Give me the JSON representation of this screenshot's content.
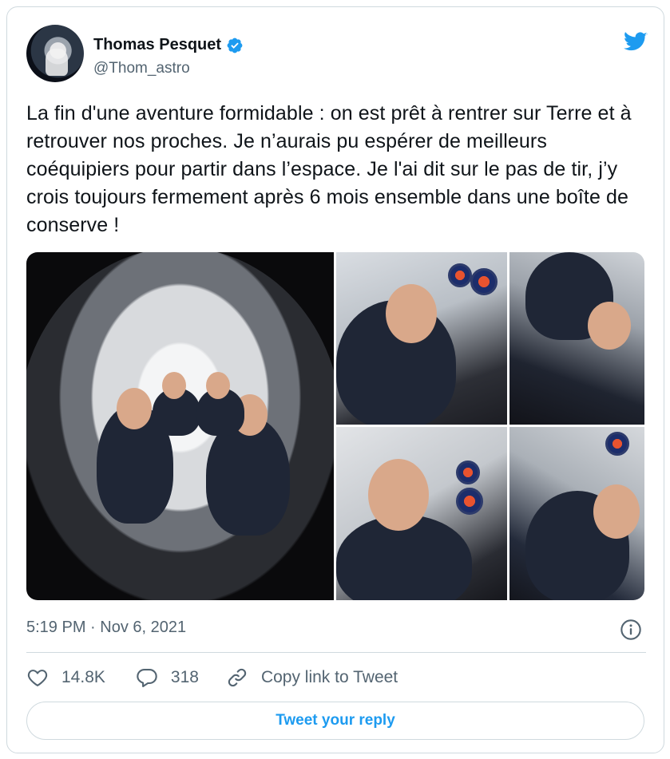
{
  "author": {
    "display_name": "Thomas Pesquet",
    "handle": "@Thom_astro",
    "verified": true
  },
  "tweet": {
    "text": "La fin d'une aventure formidable : on est prêt à rentrer sur Terre et à retrouver nos proches. Je n’aurais pu espérer de meilleurs coéquipiers pour partir dans l’espace. Je l'ai dit sur le pas de tir, j’y crois toujours fermement après 6 mois ensemble dans une boîte de conserve !",
    "timestamp": "5:19 PM · Nov 6, 2021"
  },
  "media": {
    "count": 5
  },
  "actions": {
    "likes": "14.8K",
    "replies": "318",
    "copy_link": "Copy link to Tweet"
  },
  "reply_button": {
    "label": "Tweet your reply"
  },
  "icons": {
    "brand": "twitter-bird-icon",
    "verified": "verified-badge-icon",
    "info": "info-icon",
    "like": "heart-icon",
    "reply": "reply-bubble-icon",
    "link": "link-icon"
  },
  "colors": {
    "accent": "#1d9bf0",
    "secondary_text": "#536471",
    "border": "#cfd9de"
  }
}
